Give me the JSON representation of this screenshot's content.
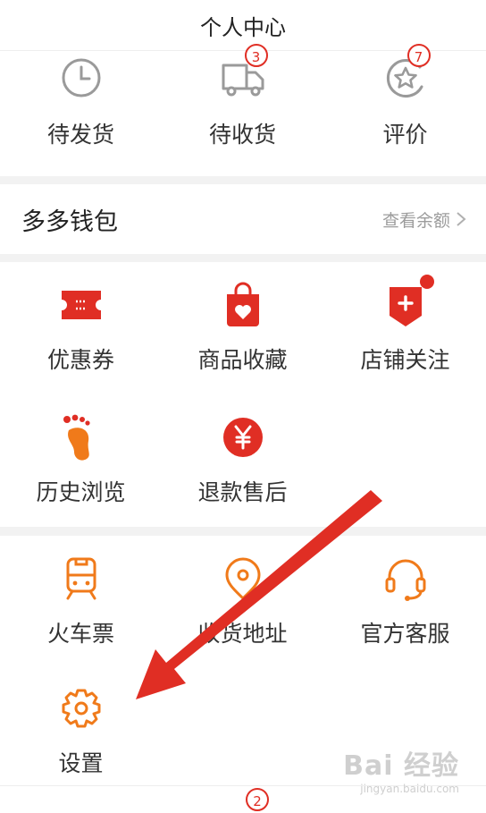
{
  "header": {
    "title": "个人中心"
  },
  "orders": {
    "items": [
      {
        "label": "待发货",
        "icon": "clock-icon"
      },
      {
        "label": "待收货",
        "icon": "truck-icon",
        "badge": "3"
      },
      {
        "label": "评价",
        "icon": "star-review-icon",
        "badge": "7"
      }
    ]
  },
  "wallet": {
    "title": "多多钱包",
    "link_label": "查看余额"
  },
  "services": {
    "items": [
      {
        "label": "优惠券",
        "icon": "coupon-icon"
      },
      {
        "label": "商品收藏",
        "icon": "favorite-bag-icon"
      },
      {
        "label": "店铺关注",
        "icon": "store-follow-icon"
      },
      {
        "label": "历史浏览",
        "icon": "footprint-icon"
      },
      {
        "label": "退款售后",
        "icon": "refund-yuan-icon"
      }
    ]
  },
  "tools": {
    "items": [
      {
        "label": "火车票",
        "icon": "train-icon"
      },
      {
        "label": "收货地址",
        "icon": "location-pin-icon"
      },
      {
        "label": "官方客服",
        "icon": "headset-icon"
      },
      {
        "label": "设置",
        "icon": "settings-gear-icon"
      }
    ]
  },
  "bottom": {
    "badge": "2"
  },
  "watermark": {
    "logo": "Bai 经验",
    "sub": "jingyan.baidu.com"
  },
  "colors": {
    "accent": "#e02e24",
    "orange": "#f07a1a",
    "gray_icon": "#9a9a9a",
    "divider": "#f2f2f2"
  }
}
